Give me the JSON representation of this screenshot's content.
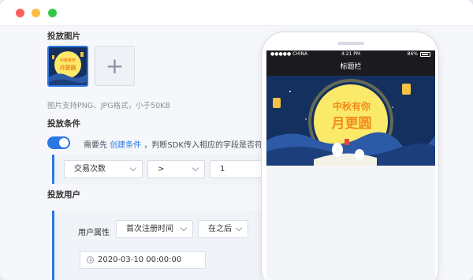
{
  "window": {
    "controls": [
      "close",
      "minimize",
      "maximize"
    ]
  },
  "form": {
    "image_section": {
      "title": "投放图片",
      "add_icon": "+",
      "hint": "图片支持PNG、JPG格式，小于50KB"
    },
    "condition_section": {
      "title": "投放条件",
      "toggle_on": true,
      "text_prefix": "需要先",
      "create_link": "创建条件",
      "text_suffix": "，判断SDK传入相应的字段是否符",
      "rule": {
        "field": "交易次数",
        "operator": ">",
        "value": "1"
      }
    },
    "user_section": {
      "title": "投放用户",
      "attr_label": "用户属性",
      "attr_value": "首次注册时间",
      "relation_value": "在之后",
      "datetime_value": "2020-03-10 00:00:00"
    }
  },
  "preview": {
    "status_left": "●●●●● CHINA",
    "status_time": "4:21 PM",
    "status_battery": "86%",
    "nav_title": "标题栏",
    "banner_line1": "中秋有你",
    "banner_line2": "月更圆",
    "thumb_line1": "中秋有你",
    "thumb_line2": "月更圆"
  },
  "colors": {
    "accent": "#2b78e4",
    "banner_text": "#f28a1c",
    "moon": "#fbe96a",
    "night": "#14305f"
  }
}
